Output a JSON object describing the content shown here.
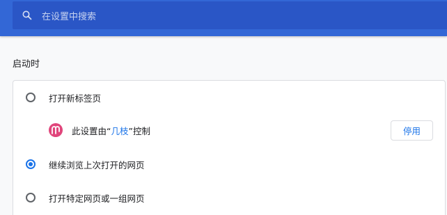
{
  "search": {
    "placeholder": "在设置中搜索",
    "icon": "search-icon"
  },
  "section": {
    "title": "启动时"
  },
  "startup_options": [
    {
      "label": "打开新标签页",
      "checked": false
    },
    {
      "label": "继续浏览上次打开的网页",
      "checked": true
    },
    {
      "label": "打开特定网页或一组网页",
      "checked": false
    }
  ],
  "extension_notice": {
    "prefix": "此设置由“",
    "extension_name": "几枝",
    "suffix": "”控制",
    "button_label": "停用",
    "logo_color": "#e0457b"
  },
  "colors": {
    "topbar": "#3367d6",
    "accent": "#1a73e8"
  }
}
